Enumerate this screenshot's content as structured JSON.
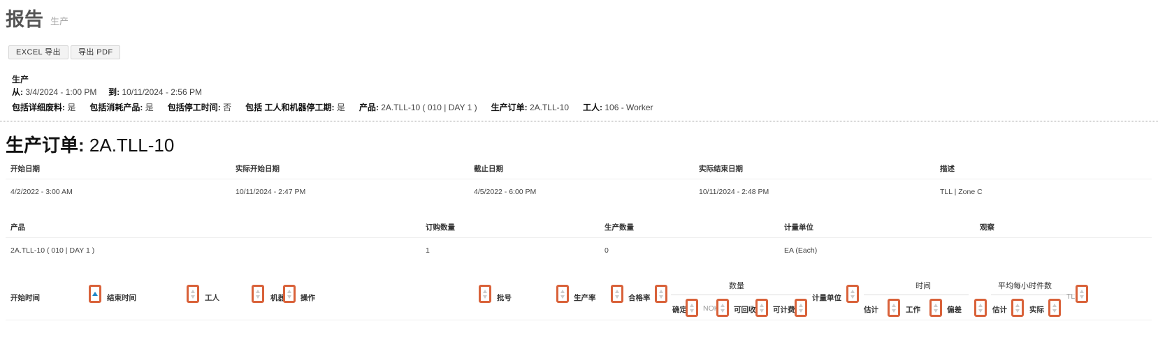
{
  "header": {
    "title": "报告",
    "subtitle": "生产"
  },
  "toolbar": {
    "excel_label": "EXCEL 导出",
    "pdf_label": "导出 PDF"
  },
  "filters": {
    "section_title": "生产",
    "from_label": "从:",
    "from_value": "3/4/2024 - 1:00 PM",
    "to_label": "到:",
    "to_value": "10/11/2024 - 2:56 PM",
    "scrap_label": "包括详细废料:",
    "scrap_value": "是",
    "consumed_label": "包括消耗产品:",
    "consumed_value": "是",
    "downtime_label": "包括停工时间:",
    "downtime_value": "否",
    "wm_downtime_label": "包括 工人和机器停工期:",
    "wm_downtime_value": "是",
    "product_label": "产品:",
    "product_value": "2A.TLL-10 ( 010 | DAY 1 )",
    "order_label": "生产订单:",
    "order_value": "2A.TLL-10",
    "worker_label": "工人:",
    "worker_value": "106 - Worker"
  },
  "order": {
    "title_label": "生产订单:",
    "title_value": "2A.TLL-10",
    "dates_headers": [
      "开始日期",
      "实际开始日期",
      "截止日期",
      "实际结束日期",
      "描述"
    ],
    "dates_values": [
      "4/2/2022 - 3:00 AM",
      "10/11/2024 - 2:47 PM",
      "4/5/2022 - 6:00 PM",
      "10/11/2024 - 2:48 PM",
      "TLL | Zone C"
    ],
    "product_headers": [
      "产品",
      "订购数量",
      "生产数量",
      "计量单位",
      "观察"
    ],
    "product_values": [
      "2A.TLL-10 ( 010 | DAY 1 )",
      "1",
      "0",
      "EA (Each)",
      ""
    ]
  },
  "table": {
    "columns": {
      "start_time": "开始时间",
      "end_time": "结束时间",
      "worker": "工人",
      "machine": "机器",
      "operation": "操作",
      "lot": "批号",
      "rate": "生产率",
      "pass_rate": "合格率",
      "uom": "计量单位",
      "tl": "TLL"
    },
    "groups": {
      "quantity": "数量",
      "time": "时间",
      "avg_pieces": "平均每小时件数"
    },
    "sub": {
      "confirmed": "确定",
      "nok": "NOK",
      "recyclable": "可回收",
      "billable": "可计费",
      "estimate": "估计",
      "work": "工作",
      "deviation": "偏差",
      "avg_estimate": "估计",
      "actual": "实际"
    }
  },
  "colors": {
    "sort_border": "#d9623a",
    "sort_active": "#1f86c8",
    "title_gray": "#555555"
  }
}
